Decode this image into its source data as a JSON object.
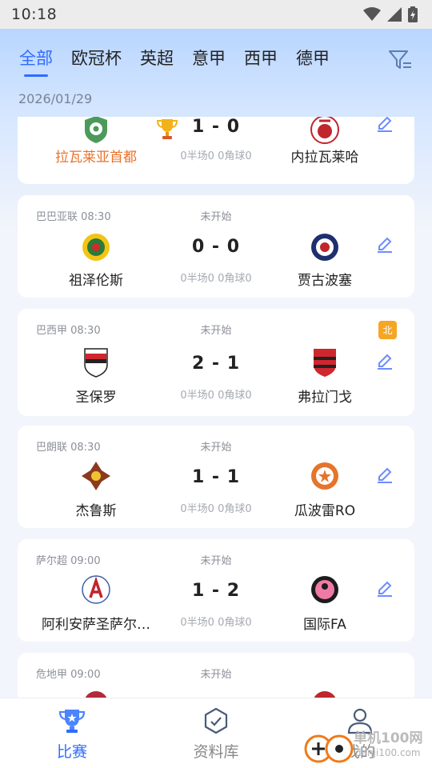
{
  "status_bar": {
    "time": "10:18"
  },
  "tabs": [
    {
      "label": "全部",
      "active": true
    },
    {
      "label": "欧冠杯"
    },
    {
      "label": "英超"
    },
    {
      "label": "意甲"
    },
    {
      "label": "西甲"
    },
    {
      "label": "德甲"
    }
  ],
  "date": "2026/01/29",
  "matches": [
    {
      "league": "",
      "status": "",
      "home": "拉瓦莱亚首都",
      "away": "内拉瓦莱哈",
      "score": "1 - 0",
      "stats": "0半场0 0角球0",
      "badge": ""
    },
    {
      "league": "巴巴亚联 08:30",
      "status": "未开始",
      "home": "祖泽伦斯",
      "away": "贾古波塞",
      "score": "0 - 0",
      "stats": "0半场0 0角球0",
      "badge": ""
    },
    {
      "league": "巴西甲 08:30",
      "status": "未开始",
      "home": "圣保罗",
      "away": "弗拉门戈",
      "score": "2 - 1",
      "stats": "0半场0 0角球0",
      "badge": "北"
    },
    {
      "league": "巴朗联 08:30",
      "status": "未开始",
      "home": "杰鲁斯",
      "away": "瓜波雷RO",
      "score": "1 - 1",
      "stats": "0半场0 0角球0",
      "badge": ""
    },
    {
      "league": "萨尔超 09:00",
      "status": "未开始",
      "home": "阿利安萨圣萨尔…",
      "away": "国际FA",
      "score": "1 - 2",
      "stats": "0半场0 0角球0",
      "badge": ""
    },
    {
      "league": "危地甲 09:00",
      "status": "未开始"
    }
  ],
  "bottom_nav": [
    {
      "label": "比赛",
      "active": true
    },
    {
      "label": "资料库"
    },
    {
      "label": "我的"
    }
  ],
  "watermark": {
    "brand": "单机100网",
    "url": "danji100.com"
  },
  "colors": {
    "accent": "#2f6bff",
    "highlight": "#e8722b",
    "badge": "#f5a623"
  }
}
